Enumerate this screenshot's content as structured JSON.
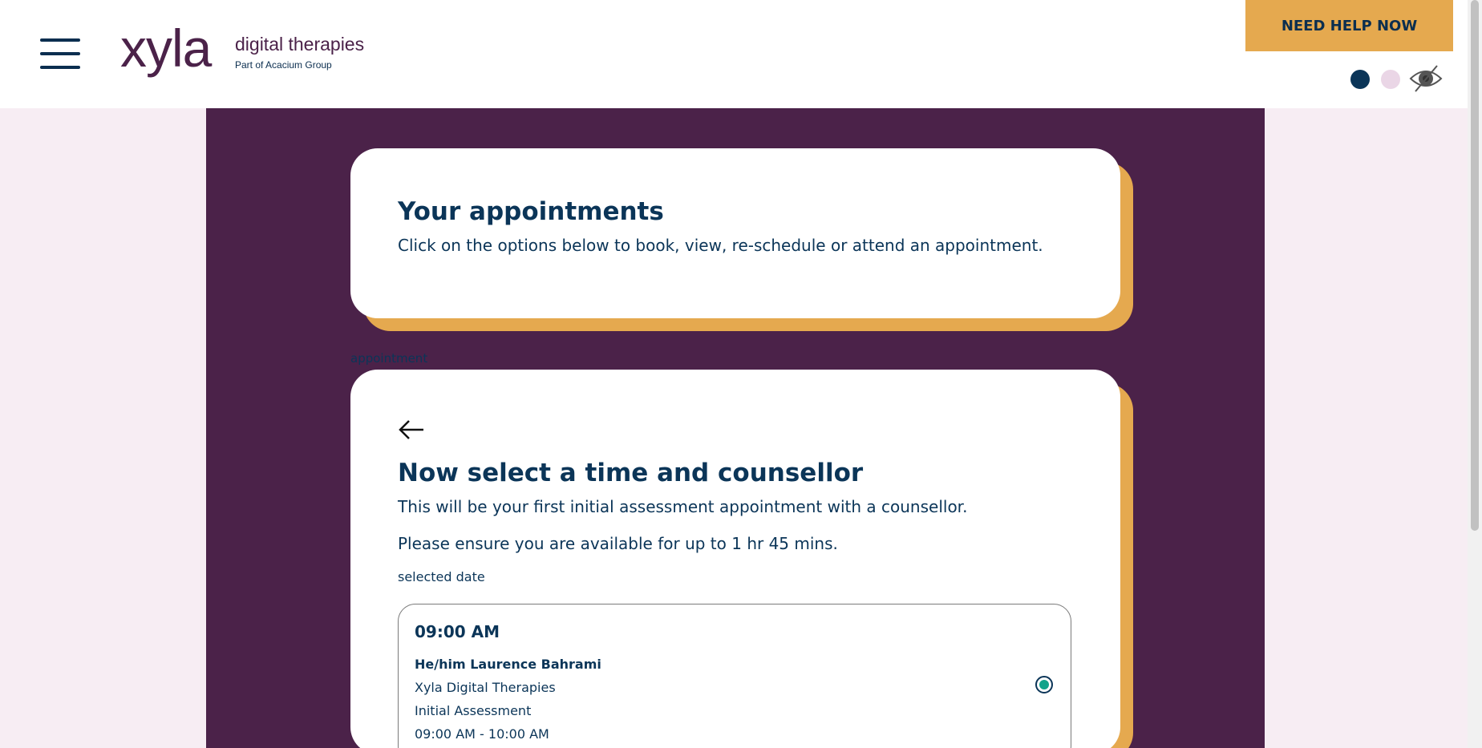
{
  "header": {
    "logo_word": "xyla",
    "logo_sub": "digital therapies",
    "logo_group": "Part of Acacium Group",
    "help_button": "NEED HELP NOW",
    "menu_icon": "hamburger-icon",
    "theme_navy_color": "#0b3558",
    "theme_pink_color": "#ead6e6",
    "eye_icon": "eye-off-icon"
  },
  "intro_card": {
    "title": "Your appointments",
    "description": "Click on the options below to book, view, re-schedule or attend an appointment."
  },
  "appointment_label": "appointment",
  "booking_card": {
    "back_icon": "arrow-left-icon",
    "title": "Now select a time and counsellor",
    "line1": "This will be your first initial assessment appointment with a counsellor.",
    "line2": "Please ensure you are available for up to 1 hr 45 mins.",
    "selected_date_label": "selected date",
    "slot": {
      "time": "09:00 AM",
      "counsellor": "He/him Laurence Bahrami",
      "provider": "Xyla Digital Therapies",
      "type": "Initial Assessment",
      "range": "09:00 AM - 10:00 AM",
      "selected": true
    }
  },
  "colors": {
    "panel": "#4b2249",
    "accent": "#e5a94f",
    "text": "#0b3558",
    "page_bg": "#f7edf3",
    "radio_selected": "#11a38a"
  }
}
